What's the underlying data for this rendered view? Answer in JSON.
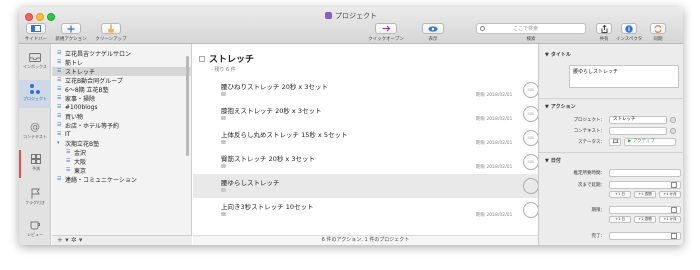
{
  "window": {
    "title": "プロジェクト"
  },
  "toolbar": {
    "sidebar_label": "サイドバー",
    "new_action_label": "新規アクション",
    "cleanup_label": "クリーンアップ",
    "quick_open_label": "クイックオープン",
    "show_label": "表示",
    "search_label": "検索",
    "search_placeholder": "ここで検索",
    "share_label": "共有",
    "inspector_label": "インスペクタ",
    "sync_label": "同期"
  },
  "strip": {
    "inbox": "インボックス",
    "projects": "プロジェクト",
    "contexts": "コンテキスト",
    "forecast": "予測",
    "flagged": "フラグ付き",
    "review": "レビュー"
  },
  "projects": [
    "立花昌吉ツナゲルサロン",
    "筋トレ",
    "ストレッチ",
    "立花B動合同グループ",
    "6〜8期 立花B塾",
    "家事・掃除",
    "#100blogs",
    "買い物",
    "お店・ホテル等予約",
    "IT",
    "次期立花B塾",
    "金沢",
    "大阪",
    "東京",
    "連絡・コミュニケーション"
  ],
  "project_footer": "+ ▾  ✲ ▾",
  "main": {
    "project_title": "ストレッチ",
    "project_sub": "- 残り 6 件",
    "tasks": [
      {
        "name": "腰ひねりストレッチ 20秒 x 3セット",
        "due": "期限 2018/02/01",
        "circle": "000"
      },
      {
        "name": "膝抱えストレッチ 20秒 x 3セット",
        "due": "期限 2018/02/01",
        "circle": "000"
      },
      {
        "name": "上体反らし丸めストレッチ 15秒 x 5セット",
        "due": "期限 2018/02/01",
        "circle": "000"
      },
      {
        "name": "臀筋ストレッチ 20秒 x 3セット",
        "due": "期限 2018/02/01",
        "circle": "000"
      },
      {
        "name": "腰ゆらしストレッチ",
        "due": "",
        "circle": ""
      },
      {
        "name": "上向き3秒ストレッチ 10セット",
        "due": "期限 2018/02/01",
        "circle": ""
      }
    ],
    "footer": "6 件のアクション, 1 件のプロジェクト"
  },
  "inspector": {
    "title_header": "タイトル",
    "title_value": "腰ゆらしストレッチ",
    "action_header": "アクション",
    "project_label": "プロジェクト：",
    "project_value": "ストレッチ",
    "context_label": "コンテキスト：",
    "context_value": "",
    "status_label": "ステータス：",
    "status_value": "アクティブ",
    "date_header": "日付",
    "estimate_label": "推定所要時間：",
    "defer_label": "次まで延期：",
    "due_label": "期限：",
    "completed_label": "完了：",
    "quick_buttons": [
      "+1 日",
      "+1 週間",
      "+1 か月"
    ]
  },
  "colors": {
    "accent": "#2f73d8",
    "selected_row": "#d6d6d6",
    "status_green": "#3aa84a"
  }
}
